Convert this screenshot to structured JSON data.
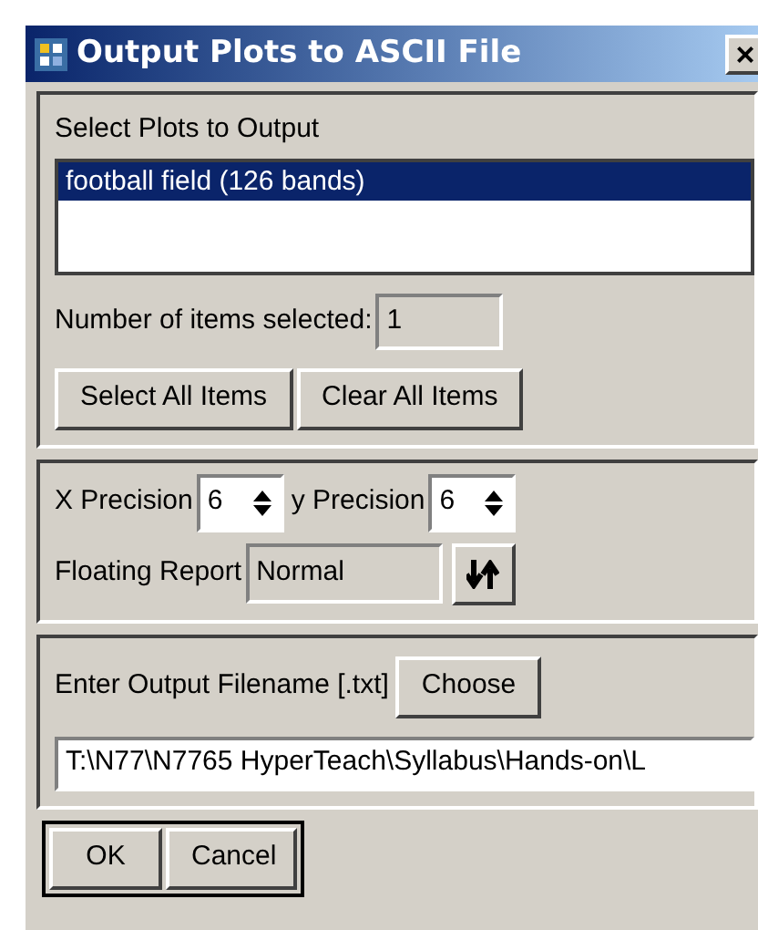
{
  "window": {
    "title": "Output Plots to ASCII File",
    "close": "×"
  },
  "plots": {
    "label": "Select Plots to Output",
    "items": [
      {
        "label": "football field (126 bands)",
        "selected": true
      }
    ],
    "count_label": "Number of items selected:",
    "count": "1",
    "buttons": [
      "Select All Items",
      "Clear All Items"
    ]
  },
  "precision": {
    "x_label": "X Precision",
    "x_value": "6",
    "y_label": "y Precision",
    "y_value": "6",
    "report_label": "Floating Report",
    "report_value": "Normal"
  },
  "output": {
    "label": "Enter Output Filename [.txt]",
    "choose": "Choose",
    "filename": "T:\\N77\\N7765 HyperTeach\\Syllabus\\Hands-on\\L"
  },
  "buttons": [
    "OK",
    "Cancel"
  ]
}
